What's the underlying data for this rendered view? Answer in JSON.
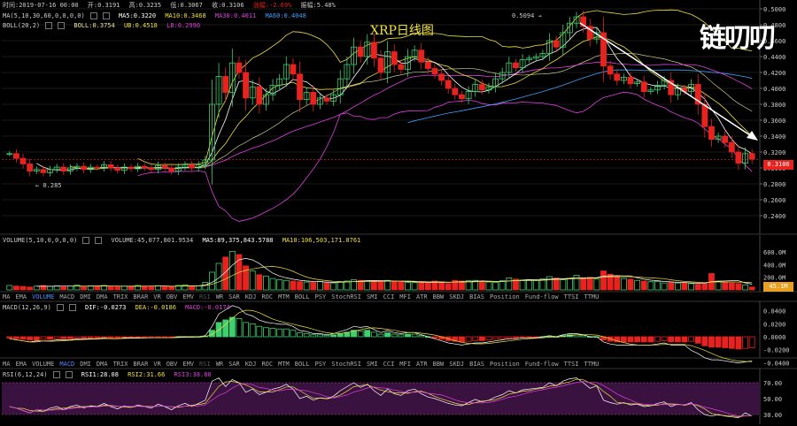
{
  "header": {
    "time": "时间:2019-07-16 00:00",
    "open": "开:0.3191",
    "high": "高:0.3235",
    "low": "低:0.3067",
    "close": "收:0.3106",
    "change": "涨幅:-2.69%",
    "amplitude": "振幅:5.48%"
  },
  "main": {
    "title": "XRP日线图",
    "ma_label": "MA(5,10,30,60,0,0,0,0)",
    "ma5": "MA5:0.3220",
    "ma10": "MA10:0.3468",
    "ma30": "MA30:0.4011",
    "ma60": "MA60:0.4048",
    "boll_label": "BOLL(20,2)",
    "boll": "BOLL:0.3754",
    "ub": "UB:0.4518",
    "lb": "LB:0.2990",
    "high_mark": "0.5094",
    "low_mark": "0.285",
    "last_price": "0.3106",
    "watermark": "链叨叨"
  },
  "volume": {
    "label": "VOLUME(5,10,0,0,0,0)",
    "volume": "VOLUME:45,077,801.9534",
    "ma5": "MA5:89,375,843.5788",
    "ma10": "MA10:106,503,171.0761",
    "last": "45.1M"
  },
  "macd": {
    "label": "MACD(12,26,9)",
    "dif": "DIF:-0.0273",
    "dea": "DEA:-0.0186",
    "macd": "MACD:-0.0174"
  },
  "rsi": {
    "label": "RSI(6,12,24)",
    "rsi1": "RSI1:28.08",
    "rsi2": "RSI2:31.66",
    "rsi3": "RSI3:38.80"
  },
  "tabs_volume": [
    "MA",
    "EMA",
    "VOLUME",
    "MACD",
    "DMI",
    "DMA",
    "TRIX",
    "BRAR",
    "VR",
    "OBV",
    "EMV",
    "RSI",
    "WR",
    "SAR",
    "KDJ",
    "ROC",
    "MTM",
    "BOLL",
    "PSY",
    "StochRSI",
    "SMI",
    "CCI",
    "MFI",
    "ATR",
    "BBW",
    "SKDJ",
    "BIAS",
    "Position",
    "Fund-flow",
    "TTSI",
    "TTMU"
  ],
  "tabs_macd": [
    "MA",
    "EMA",
    "VOLUME",
    "MACD",
    "DMI",
    "DMA",
    "TRIX",
    "BRAR",
    "VR",
    "OBV",
    "EMV",
    "RSI",
    "WR",
    "SAR",
    "KDJ",
    "ROC",
    "MTM",
    "BOLL",
    "PSY",
    "StochRSI",
    "SMI",
    "CCI",
    "MFI",
    "ATR",
    "BBW",
    "SKDJ",
    "BIAS",
    "Position",
    "Fund-flow",
    "TTSI",
    "TTMU"
  ],
  "colors": {
    "up": "#3fcf6e",
    "down": "#e8231f",
    "ma5": "#ffffff",
    "ma10": "#f0e040",
    "ma30": "#e040e0",
    "ma60": "#40a0ff",
    "boll": "#e8e8a0",
    "ub": "#f0e040",
    "lb": "#e040e0"
  },
  "chart_data": [
    {
      "type": "candlestick",
      "axis": {
        "ylim": [
          0.22,
          0.5
        ],
        "yticks": [
          "0.5000",
          "0.4800",
          "0.4600",
          "0.4400",
          "0.4200",
          "0.4000",
          "0.3800",
          "0.3600",
          "0.3400",
          "0.3200",
          "0.3000",
          "0.2800",
          "0.2600",
          "0.2400"
        ]
      },
      "closes": [
        0.318,
        0.312,
        0.305,
        0.296,
        0.298,
        0.294,
        0.298,
        0.301,
        0.296,
        0.3,
        0.302,
        0.298,
        0.301,
        0.3,
        0.304,
        0.3,
        0.297,
        0.301,
        0.299,
        0.302,
        0.3,
        0.298,
        0.303,
        0.3,
        0.296,
        0.301,
        0.304,
        0.3,
        0.304,
        0.31,
        0.38,
        0.415,
        0.395,
        0.432,
        0.42,
        0.388,
        0.402,
        0.38,
        0.392,
        0.404,
        0.412,
        0.43,
        0.418,
        0.386,
        0.395,
        0.38,
        0.388,
        0.384,
        0.392,
        0.412,
        0.43,
        0.452,
        0.44,
        0.458,
        0.438,
        0.42,
        0.446,
        0.43,
        0.424,
        0.44,
        0.448,
        0.433,
        0.425,
        0.418,
        0.41,
        0.4,
        0.392,
        0.387,
        0.396,
        0.405,
        0.398,
        0.402,
        0.412,
        0.42,
        0.432,
        0.426,
        0.436,
        0.438,
        0.44,
        0.444,
        0.46,
        0.452,
        0.47,
        0.482,
        0.49,
        0.478,
        0.462,
        0.47,
        0.428,
        0.418,
        0.41,
        0.414,
        0.406,
        0.408,
        0.396,
        0.398,
        0.404,
        0.41,
        0.392,
        0.4,
        0.396,
        0.405,
        0.38,
        0.352,
        0.336,
        0.34,
        0.332,
        0.32,
        0.306,
        0.318,
        0.311
      ]
    },
    {
      "type": "bar",
      "name": "volume",
      "axis": {
        "ylim": [
          0,
          700
        ],
        "yticks": [
          "600.0M",
          "400.0M",
          "200.0M"
        ]
      },
      "values": [
        70,
        60,
        55,
        45,
        60,
        70,
        55,
        65,
        50,
        60,
        75,
        50,
        65,
        60,
        70,
        55,
        50,
        60,
        55,
        70,
        60,
        55,
        65,
        60,
        50,
        70,
        80,
        60,
        65,
        120,
        280,
        420,
        520,
        610,
        560,
        380,
        300,
        240,
        220,
        180,
        160,
        150,
        140,
        130,
        125,
        120,
        135,
        115,
        110,
        130,
        140,
        160,
        150,
        145,
        140,
        135,
        150,
        130,
        125,
        120,
        115,
        120,
        110,
        140,
        125,
        100,
        150,
        140,
        145,
        150,
        130,
        125,
        120,
        145,
        190,
        170,
        150,
        160,
        150,
        175,
        210,
        190,
        160,
        180,
        230,
        190,
        200,
        170,
        300,
        250,
        210,
        180,
        170,
        150,
        140,
        130,
        135,
        110,
        120,
        110,
        115,
        100,
        90,
        95,
        260,
        140,
        120,
        110,
        100,
        80,
        45
      ]
    },
    {
      "type": "bar",
      "name": "macd",
      "axis": {
        "ylim": [
          -0.03,
          0.045
        ],
        "yticks": [
          "0.0400",
          "0.0200",
          "0.0000",
          "-0.0200",
          "-0.0400"
        ]
      },
      "values": [
        -0.002,
        -0.003,
        -0.004,
        -0.005,
        -0.005,
        -0.004,
        -0.004,
        -0.003,
        -0.003,
        -0.003,
        -0.002,
        -0.002,
        -0.002,
        -0.002,
        -0.001,
        -0.002,
        -0.002,
        -0.001,
        -0.001,
        -0.001,
        -0.001,
        -0.001,
        -0.001,
        -0.001,
        -0.001,
        0.0,
        0.0,
        0.0,
        0.0,
        0.001,
        0.01,
        0.022,
        0.026,
        0.03,
        0.028,
        0.022,
        0.02,
        0.016,
        0.014,
        0.013,
        0.012,
        0.012,
        0.01,
        0.006,
        0.005,
        0.003,
        0.003,
        0.002,
        0.003,
        0.005,
        0.007,
        0.01,
        0.009,
        0.01,
        0.007,
        0.004,
        0.006,
        0.004,
        0.003,
        0.004,
        0.004,
        0.002,
        0.0,
        -0.002,
        -0.004,
        -0.006,
        -0.007,
        -0.008,
        -0.007,
        -0.006,
        -0.006,
        -0.005,
        -0.004,
        -0.003,
        -0.002,
        -0.002,
        -0.001,
        -0.001,
        -0.001,
        0.0,
        0.001,
        0.0,
        0.002,
        0.003,
        0.003,
        0.002,
        0.0,
        0.0,
        -0.005,
        -0.007,
        -0.008,
        -0.008,
        -0.008,
        -0.008,
        -0.008,
        -0.008,
        -0.007,
        -0.006,
        -0.008,
        -0.008,
        -0.008,
        -0.007,
        -0.01,
        -0.014,
        -0.016,
        -0.016,
        -0.017,
        -0.018,
        -0.019,
        -0.018,
        -0.017
      ]
    },
    {
      "type": "line",
      "name": "rsi",
      "axis": {
        "ylim": [
          20,
          80
        ],
        "yticks": [
          "70.00",
          "50.00",
          "30.00"
        ]
      },
      "values": [
        40,
        38,
        35,
        32,
        36,
        34,
        38,
        40,
        36,
        40,
        42,
        38,
        41,
        40,
        44,
        40,
        37,
        41,
        39,
        42,
        40,
        38,
        43,
        40,
        36,
        41,
        44,
        40,
        44,
        48,
        72,
        76,
        65,
        74,
        70,
        58,
        62,
        55,
        58,
        62,
        64,
        68,
        62,
        50,
        53,
        48,
        51,
        50,
        53,
        60,
        65,
        70,
        64,
        68,
        60,
        54,
        62,
        56,
        54,
        60,
        62,
        56,
        52,
        50,
        47,
        44,
        42,
        41,
        45,
        49,
        46,
        48,
        52,
        55,
        60,
        57,
        61,
        62,
        63,
        64,
        70,
        66,
        72,
        75,
        76,
        70,
        63,
        66,
        48,
        45,
        43,
        45,
        42,
        43,
        40,
        41,
        44,
        46,
        40,
        43,
        42,
        45,
        36,
        30,
        28,
        30,
        28,
        27,
        26,
        32,
        28
      ]
    }
  ]
}
